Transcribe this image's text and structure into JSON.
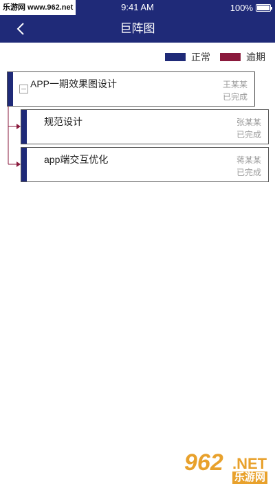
{
  "status_bar": {
    "watermark": "乐游网 www.962.net",
    "time": "9:41 AM",
    "battery": "100%"
  },
  "nav": {
    "title": "巨阵图",
    "back_icon": "chevron-left-icon"
  },
  "legend": {
    "items": [
      {
        "label": "正常",
        "color": "#1f2a78"
      },
      {
        "label": "逾期",
        "color": "#8a1a3c"
      }
    ]
  },
  "tasks": {
    "root": {
      "title": "APP一期效果图设计",
      "owner": "王某某",
      "status": "已完成"
    },
    "children": [
      {
        "title": "规范设计",
        "owner": "张某某",
        "status": "已完成"
      },
      {
        "title": "app端交互优化",
        "owner": "蒋某某",
        "status": "已完成"
      }
    ]
  },
  "colors": {
    "primary": "#1f2a78",
    "overdue": "#8a1a3c"
  },
  "watermark_bottom": {
    "number": "962",
    "net": ".NET",
    "cn": "乐游网"
  }
}
